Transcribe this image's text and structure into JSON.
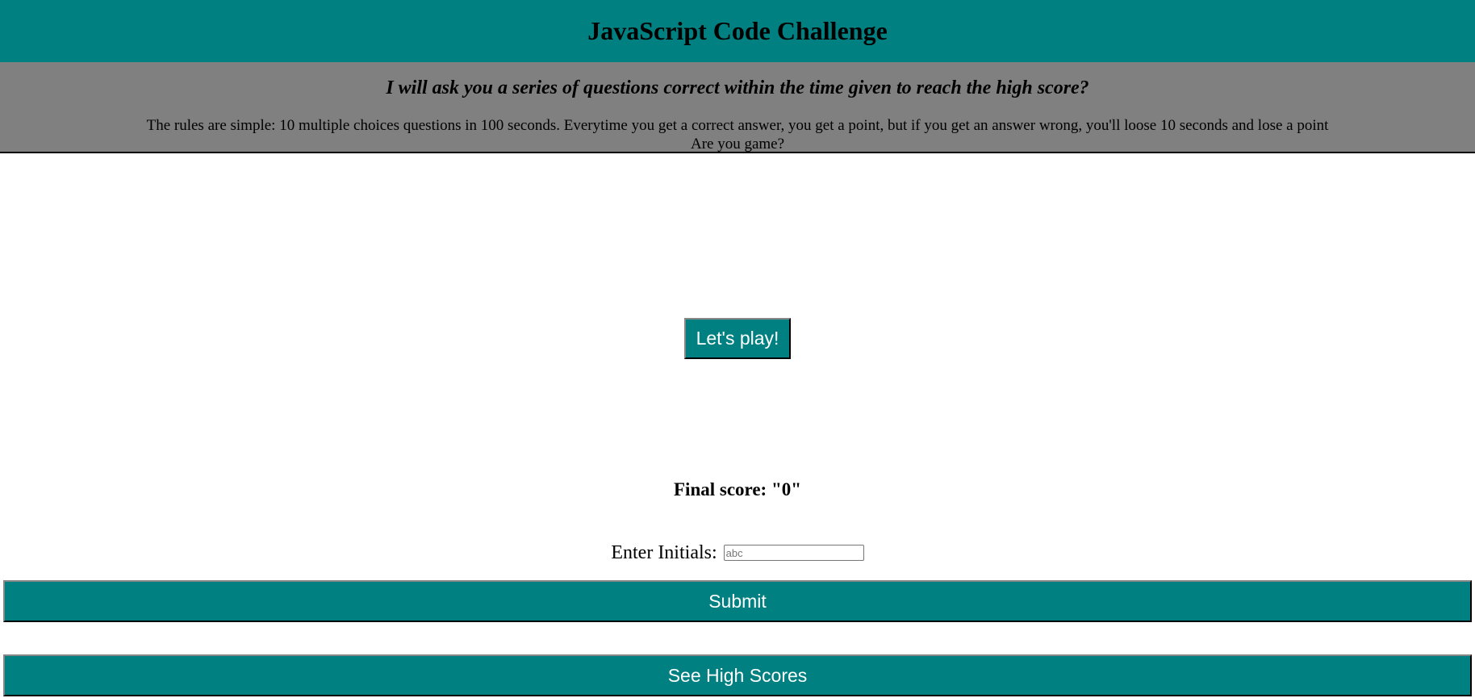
{
  "header": {
    "title": "JavaScript Code Challenge"
  },
  "intro": {
    "tagline": "I will ask you a series of questions correct within the time given to reach the high score?",
    "rules_line1": "The rules are simple: 10 multiple choices questions in 100 seconds. Everytime you get a correct answer, you get a point, but if you get an answer wrong, you'll loose 10 seconds and lose a point",
    "rules_line2": "Are you game?"
  },
  "start": {
    "button_label": "Let's play!"
  },
  "result": {
    "final_score_text": "Final score: \"0\""
  },
  "initials": {
    "label": "Enter Initials:",
    "placeholder": "abc",
    "value": ""
  },
  "actions": {
    "submit_label": "Submit",
    "high_scores_label": "See High Scores"
  },
  "colors": {
    "accent": "#008080",
    "intro_background": "#808080",
    "button_text": "#ffffff"
  }
}
